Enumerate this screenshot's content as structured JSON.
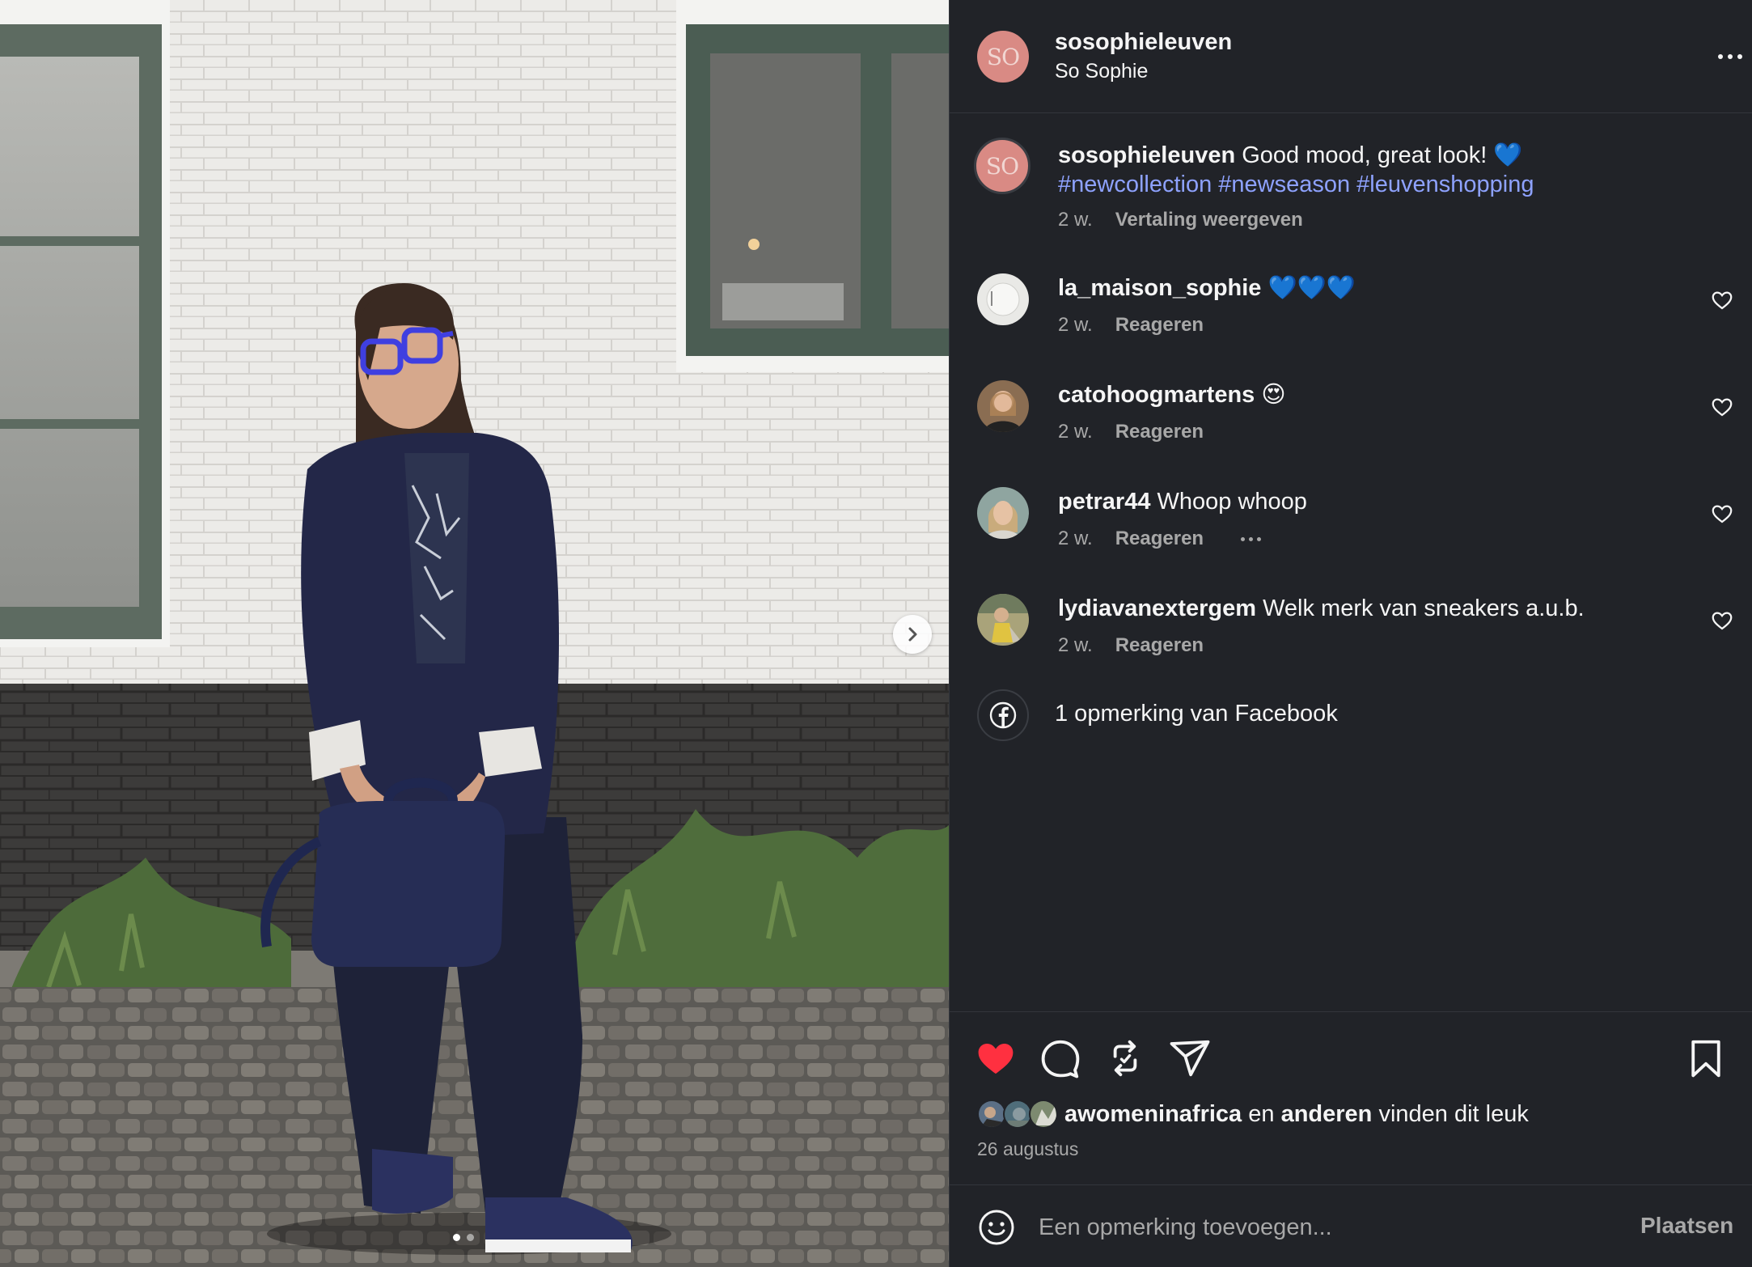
{
  "post": {
    "username": "sosophieleuven",
    "subtitle": "So Sophie",
    "avatar_monogram": "SO",
    "more_icon": "more-horizontal-icon"
  },
  "caption": {
    "username": "sosophieleuven",
    "text": "Good mood, great look! 💙",
    "hashtags": "#newcollection #newseason #leuvenshopping",
    "time": "2 w.",
    "translate": "Vertaling weergeven"
  },
  "comments": [
    {
      "username": "la_maison_sophie",
      "text": "💙💙💙",
      "time": "2 w.",
      "reply": "Reageren"
    },
    {
      "username": "catohoogmartens",
      "text": "😍",
      "time": "2 w.",
      "reply": "Reageren"
    },
    {
      "username": "petrar44",
      "text": "Whoop whoop",
      "time": "2 w.",
      "reply": "Reageren"
    },
    {
      "username": "lydiavanextergem",
      "text": "Welk merk van sneakers a.u.b.",
      "time": "2 w.",
      "reply": "Reageren"
    }
  ],
  "facebook": {
    "label": "1 opmerking van Facebook",
    "icon": "facebook-icon"
  },
  "likes": {
    "first": "awomeninafrica",
    "joiner": "en",
    "others": "anderen",
    "suffix": "vinden dit leuk"
  },
  "date": "26 augustus",
  "add_comment": {
    "placeholder": "Een opmerking toevoegen...",
    "post_label": "Plaatsen"
  },
  "carousel": {
    "current": 1,
    "total": 2
  },
  "colors": {
    "like_red": "#ff3040",
    "hashtag": "#8ea2ff",
    "panel_bg": "#212328",
    "muted": "#a8a8a8"
  }
}
